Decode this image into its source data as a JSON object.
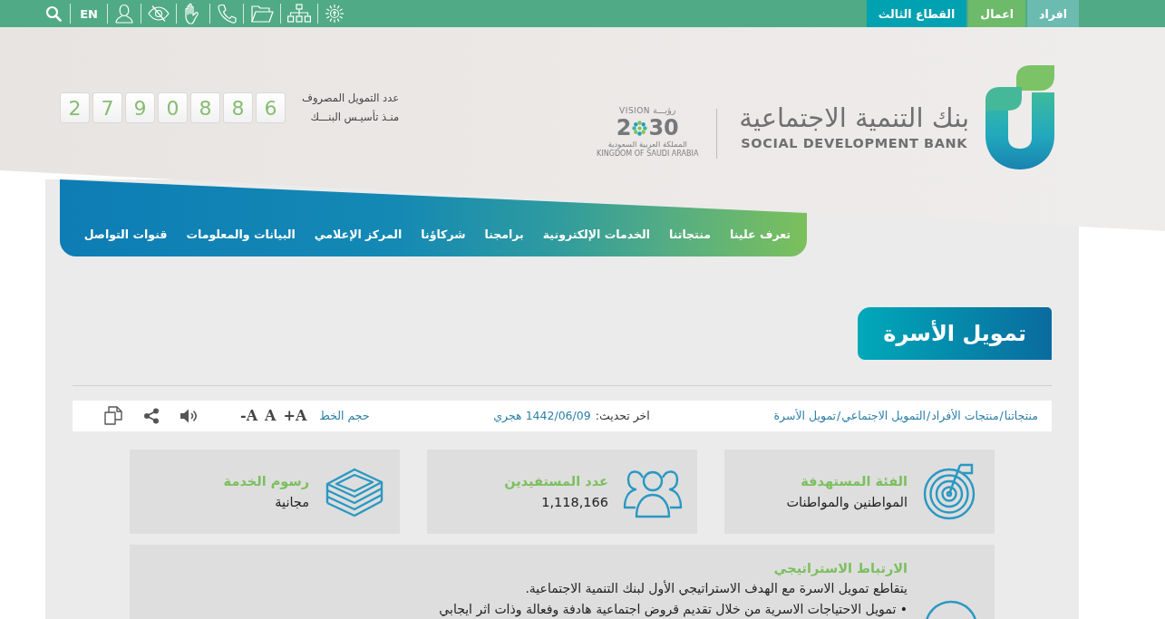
{
  "top_bar": {
    "tabs": [
      {
        "label": "افراد",
        "color": "#6cbbb0"
      },
      {
        "label": "اعمال",
        "color": "#6dba6b"
      },
      {
        "label": "القطاع الثالث",
        "color": "#00a1b1"
      }
    ],
    "language": "EN"
  },
  "header": {
    "logo": {
      "name_ar": "بنك التنمية الاجتماعية",
      "name_en": "SOCIAL DEVELOPMENT BANK"
    },
    "vision": {
      "label_en": "VISION",
      "label_ar": "رؤيـــة",
      "year_start": "2",
      "year_end": "30",
      "country_ar": "المملكة العربية السعودية",
      "country_en": "KINGDOM OF SAUDI ARABIA"
    },
    "counter": {
      "label_lines": [
        "عدد التمويل المصروف",
        "منـذ تأسيـس البنـــك"
      ],
      "digits": [
        "6",
        "8",
        "8",
        "0",
        "9",
        "7",
        "2"
      ]
    }
  },
  "nav": {
    "items": [
      "تعرف علينا",
      "منتجاتنا",
      "الخدمات الإلكترونية",
      "برامجنا",
      "شركاؤنا",
      "المركز الإعلامي",
      "البيانات والمعلومات",
      "قنوات التواصل"
    ]
  },
  "page_title": "تمويل الأسرة",
  "toolbar": {
    "breadcrumb": {
      "items": [
        "منتجاتنا",
        "منتجات الأفراد",
        "التمويل الاجتماعي",
        "تمويل الأسرة"
      ],
      "separator": "/"
    },
    "updated": {
      "label": "اخر تحديث:",
      "value": "1442/06/09 هجري"
    },
    "font_size": {
      "label": "حجم الخط",
      "options": [
        "A+",
        "A",
        "A-"
      ]
    }
  },
  "info_cards": [
    {
      "kind": "target",
      "title": "الفئة المستهدفة",
      "value": "المواطنين والمواطنات"
    },
    {
      "kind": "people",
      "title": "عدد المستفيدين",
      "value": "1,118,166"
    },
    {
      "kind": "money",
      "title": "رسوم الخدمة",
      "value": "مجانية"
    }
  ],
  "strategic": {
    "title": "الارتباط الاستراتيجي",
    "paragraph": "يتقاطع تمويل الاسرة مع الهدف الاستراتيجي الأول لبنك التنمية الاجتماعية.",
    "bullets": [
      "• تمويل الاحتياجات الاسرية من خلال تقديم قروض اجتماعية هادفة وفعالة وذات اثر ايجابي"
    ]
  }
}
